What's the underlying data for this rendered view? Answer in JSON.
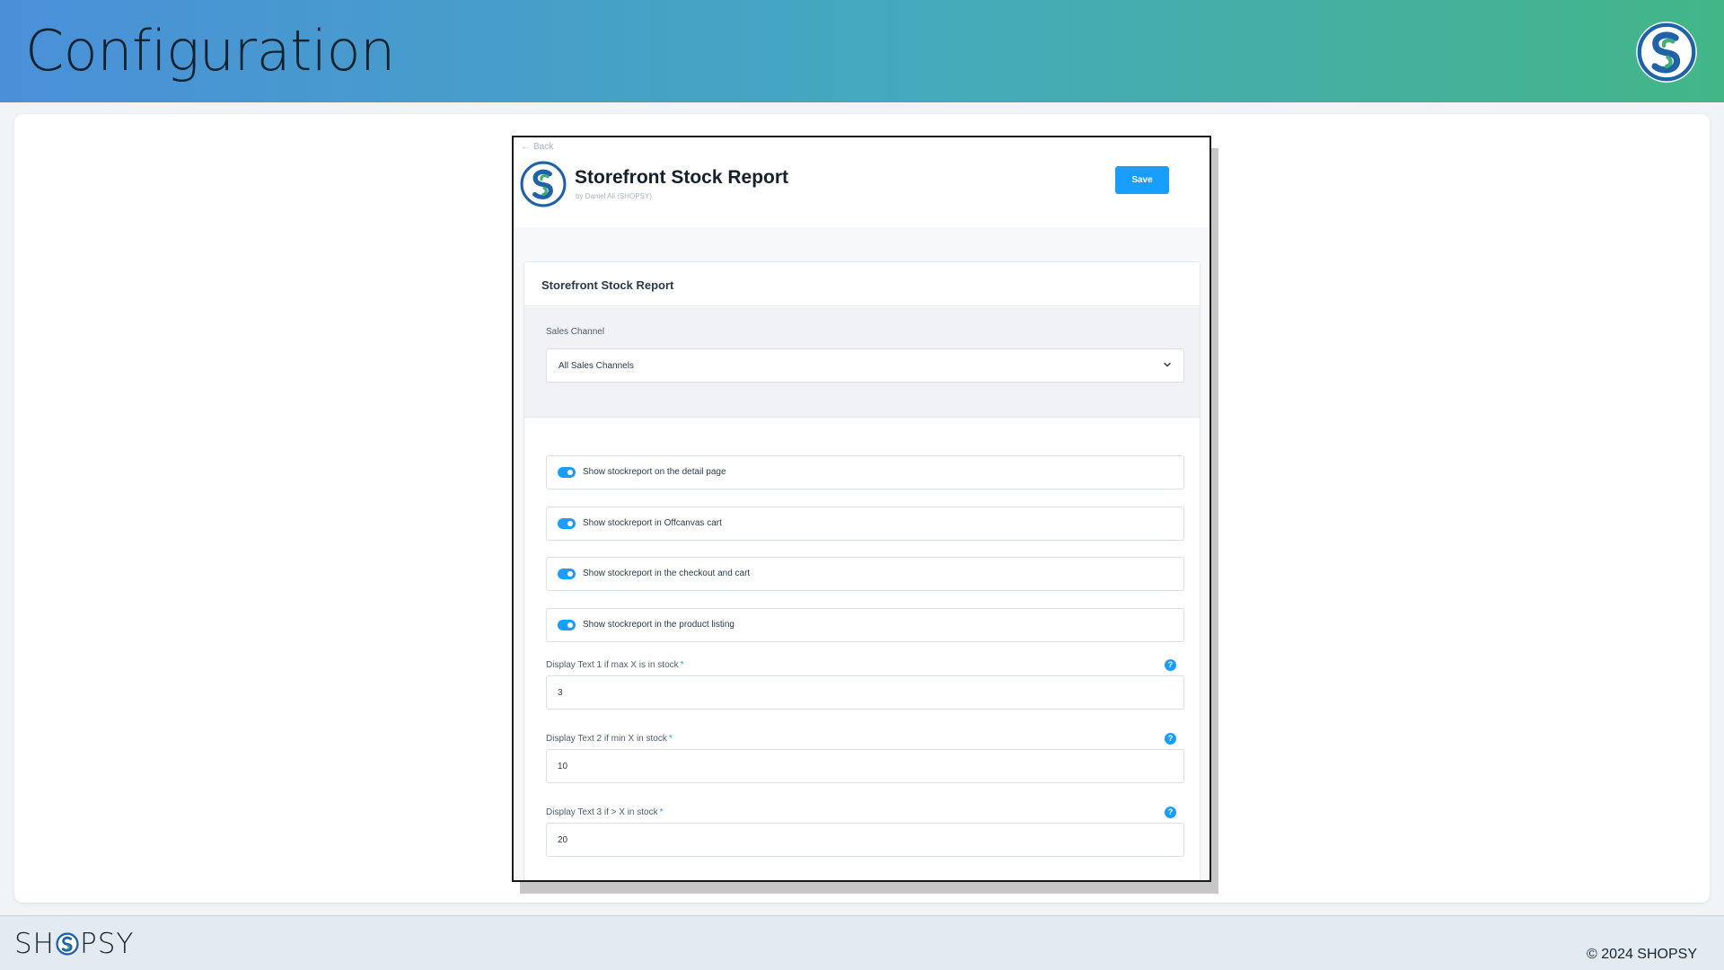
{
  "banner": {
    "title": "Configuration",
    "logo_icon": "shopsy-logo-icon"
  },
  "app": {
    "back_label": "Back",
    "title": "Storefront Stock Report",
    "subtitle": "by Daniel Ali (SHOPSY)",
    "save_label": "Save"
  },
  "panel": {
    "title": "Storefront Stock Report",
    "sales_channel": {
      "label": "Sales Channel",
      "value": "All Sales Channels"
    },
    "toggles": [
      {
        "label": "Show stockreport on the detail page",
        "enabled": true
      },
      {
        "label": "Show stockreport in Offcanvas cart",
        "enabled": true
      },
      {
        "label": "Show stockreport in the checkout and cart",
        "enabled": true
      },
      {
        "label": "Show stockreport in the product listing",
        "enabled": true
      }
    ],
    "inputs": [
      {
        "label": "Display Text 1 if max X is in stock",
        "required": "*",
        "value": "3"
      },
      {
        "label": "Display Text 2 if min X in stock",
        "required": "*",
        "value": "10"
      },
      {
        "label": "Display Text 3 if > X in stock",
        "required": "*",
        "value": "20"
      }
    ],
    "help_glyph": "?"
  },
  "footer": {
    "brand_prefix": "SH",
    "brand_suffix": "PSY",
    "copyright": "© 2024 SHOPSY"
  },
  "colors": {
    "accent": "#189eff",
    "banner_start": "#4a90d9",
    "banner_end": "#43b688"
  }
}
